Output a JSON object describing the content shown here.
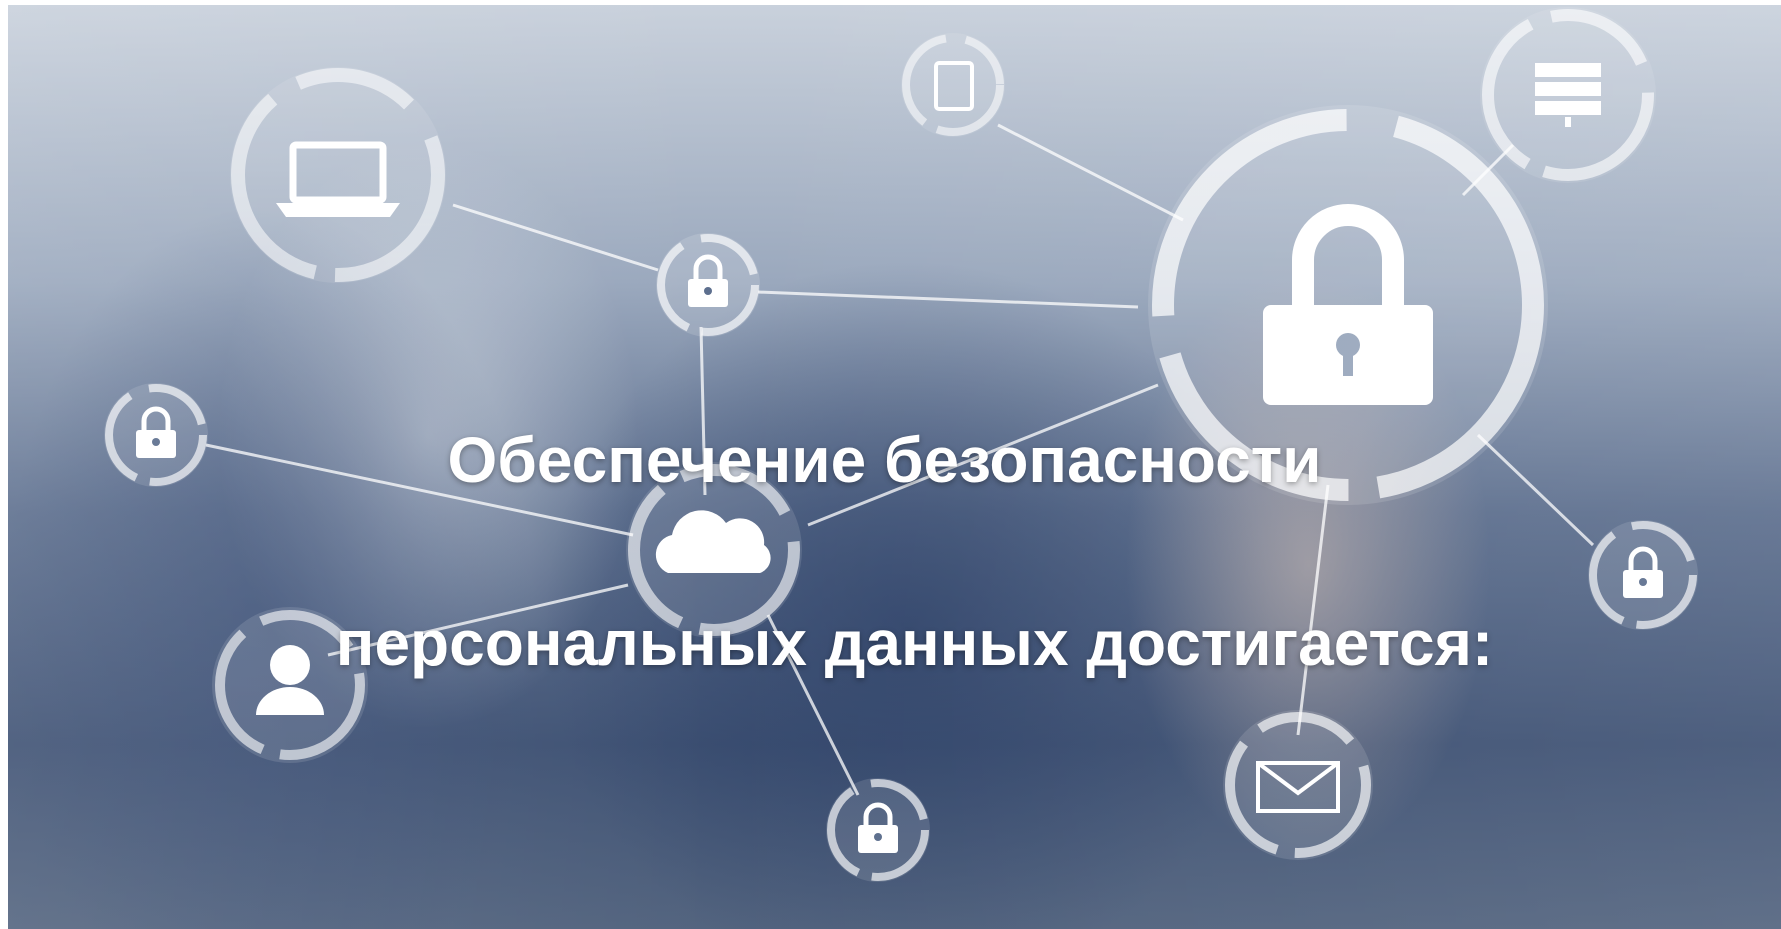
{
  "slide": {
    "title_line1": "Обеспечение безопасности",
    "title_line2": "персональных данных достигается:"
  },
  "icons": [
    "laptop-icon",
    "tablet-icon",
    "server-icon",
    "lock-icon",
    "cloud-icon",
    "user-icon",
    "envelope-icon"
  ],
  "colors": {
    "text": "#ffffff",
    "background_top": "#c9d1dc",
    "background_bottom": "#3f5274"
  }
}
